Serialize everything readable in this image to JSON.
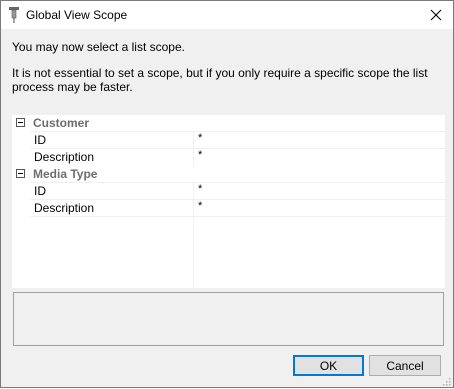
{
  "window": {
    "title": "Global View Scope",
    "close_glyph": "✕"
  },
  "messages": {
    "line1": "You may now select a list scope.",
    "line2": "It is not essential to set a scope, but if you only require a specific scope the list process may be faster."
  },
  "property_grid": {
    "categories": [
      {
        "name": "Customer",
        "expanded": true,
        "properties": [
          {
            "name": "ID",
            "value": "*"
          },
          {
            "name": "Description",
            "value": "*"
          }
        ]
      },
      {
        "name": "Media Type",
        "expanded": true,
        "properties": [
          {
            "name": "ID",
            "value": "*"
          },
          {
            "name": "Description",
            "value": "*"
          }
        ]
      }
    ]
  },
  "buttons": {
    "ok": "OK",
    "cancel": "Cancel"
  },
  "icons": {
    "app": "pin-icon",
    "close": "close-icon",
    "collapse": "minus-box-icon",
    "resize": "resize-grip-icon"
  },
  "colors": {
    "accent": "#0078d7",
    "category_text": "#6d6d6d",
    "dialog_bg": "#f0f0f0"
  }
}
